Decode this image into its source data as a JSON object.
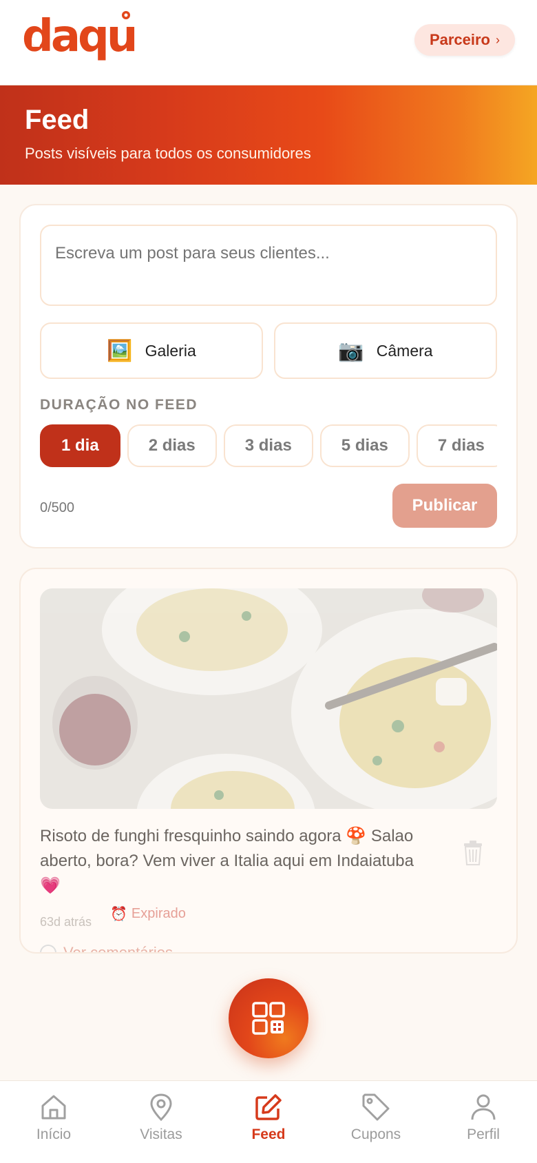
{
  "header": {
    "logo_text": "daqui",
    "partner_label": "Parceiro",
    "partner_chevron": "›",
    "brand_color": "#e2461a"
  },
  "hero": {
    "title": "Feed",
    "subtitle": "Posts visíveis para todos os consumidores"
  },
  "composer": {
    "placeholder": "Escreva um post para seus clientes...",
    "gallery_label": "Galeria",
    "gallery_icon": "🖼️",
    "camera_label": "Câmera",
    "camera_icon": "📷",
    "duration_label": "DURAÇÃO NO FEED",
    "durations": [
      "1 dia",
      "2 dias",
      "3 dias",
      "5 dias",
      "7 dias"
    ],
    "selected_duration": "1 dia",
    "char_count": "0/500",
    "publish_label": "Publicar"
  },
  "post": {
    "text": "Risoto de funghi fresquinho saindo agora 🍄 Salao aberto, bora? Vem viver a Italia aqui em Indaiatuba 💗",
    "time": "63d atrás",
    "status_icon": "⏰",
    "status": "Expirado",
    "comments_label": "Ver comentários"
  },
  "bottom_nav": {
    "items": [
      {
        "label": "Início",
        "icon": "home-icon"
      },
      {
        "label": "Visitas",
        "icon": "map-pin-icon"
      },
      {
        "label": "Feed",
        "icon": "edit-icon"
      },
      {
        "label": "Cupons",
        "icon": "tag-icon"
      },
      {
        "label": "Perfil",
        "icon": "user-icon"
      }
    ],
    "active": "Feed"
  }
}
